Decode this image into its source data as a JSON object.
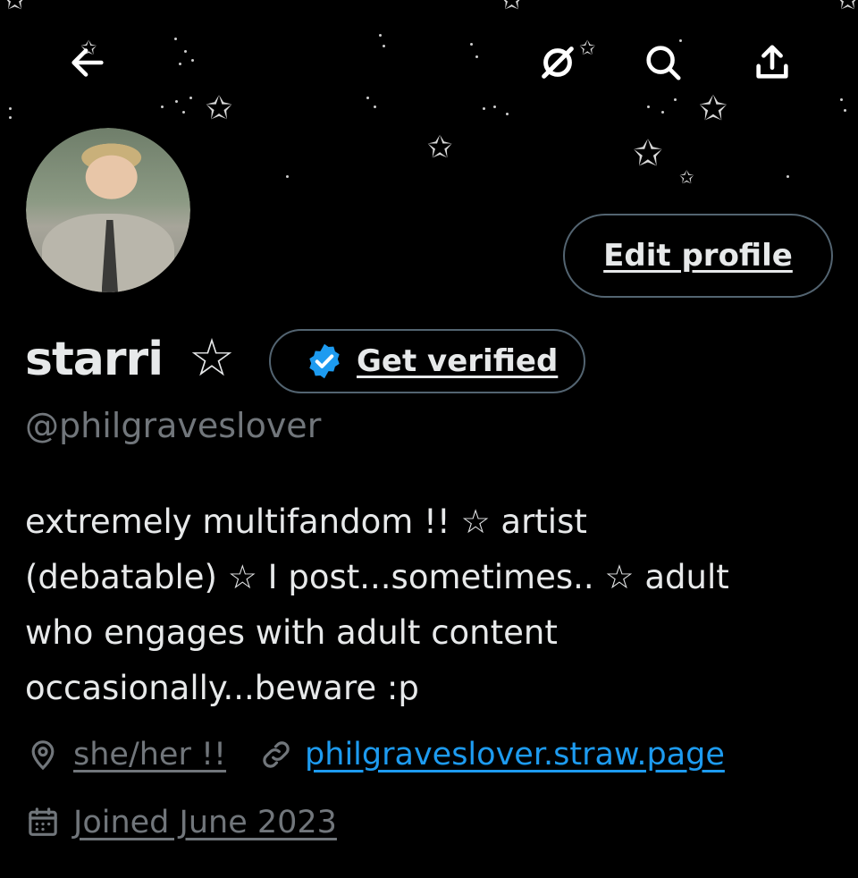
{
  "header": {
    "back_icon": "arrow-left-icon",
    "grok_icon": "slashed-circle-icon",
    "search_icon": "search-icon",
    "share_icon": "share-icon",
    "banner_style": "black starry sky"
  },
  "profile": {
    "edit_label": "Edit profile",
    "display_name": "starri",
    "name_star": "☆",
    "get_verified_label": "Get verified",
    "handle": "@philgraveslover",
    "bio_lines": [
      "extremely multifandom !! ☆ artist",
      "(debatable) ☆ I post...sometimes.. ☆ adult",
      "who engages with adult content",
      "occasionally...beware :p"
    ],
    "location": "she/her !!",
    "website": "philgraveslover.straw.page",
    "joined": "Joined June 2023"
  },
  "colors": {
    "background": "#000000",
    "text": "#e7e9ea",
    "secondary": "#71767b",
    "link": "#1d9bf0",
    "border": "#536471",
    "verified_badge": "#1d9bf0"
  }
}
